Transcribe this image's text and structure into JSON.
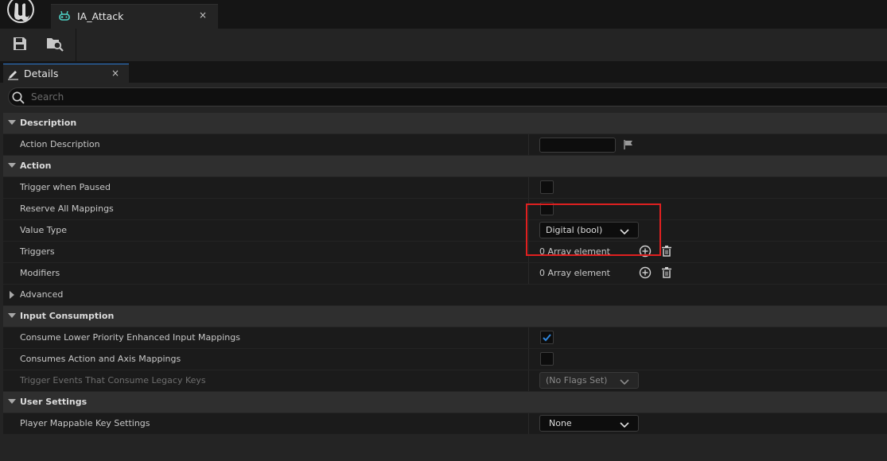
{
  "app": {
    "logo": "unreal-engine-logo"
  },
  "tabs": [
    {
      "label": "IA_Attack",
      "icon": "input-action-icon",
      "close": "×"
    }
  ],
  "toolbar": {
    "buttons": [
      "save-icon",
      "browse-to-asset-icon"
    ]
  },
  "panel": {
    "tab_label": "Details",
    "tab_close": "×",
    "tab_icon": "pencil-icon"
  },
  "search": {
    "placeholder": "Search"
  },
  "categories": {
    "description": "Description",
    "action": "Action",
    "advanced": "Advanced",
    "input_consumption": "Input Consumption",
    "user_settings": "User Settings"
  },
  "properties": {
    "action_description": {
      "label": "Action Description",
      "value": ""
    },
    "trigger_when_paused": {
      "label": "Trigger when Paused",
      "checked": false
    },
    "reserve_all_mappings": {
      "label": "Reserve All Mappings",
      "checked": false
    },
    "value_type": {
      "label": "Value Type",
      "value": "Digital (bool)"
    },
    "triggers": {
      "label": "Triggers",
      "value": "0 Array element"
    },
    "modifiers": {
      "label": "Modifiers",
      "value": "0 Array element"
    },
    "consume_lower_priority": {
      "label": "Consume Lower Priority Enhanced Input Mappings",
      "checked": true
    },
    "consumes_action_axis": {
      "label": "Consumes Action and Axis Mappings",
      "checked": false
    },
    "trigger_events_legacy": {
      "label": "Trigger Events That Consume Legacy Keys",
      "value": "(No Flags Set)",
      "enabled": false
    },
    "player_mappable_key_settings": {
      "label": "Player Mappable Key Settings",
      "value": "None"
    }
  },
  "colors": {
    "highlight": "#e02020",
    "check_accent": "#2e86de",
    "active_tab_border": "#2e7ad1"
  }
}
